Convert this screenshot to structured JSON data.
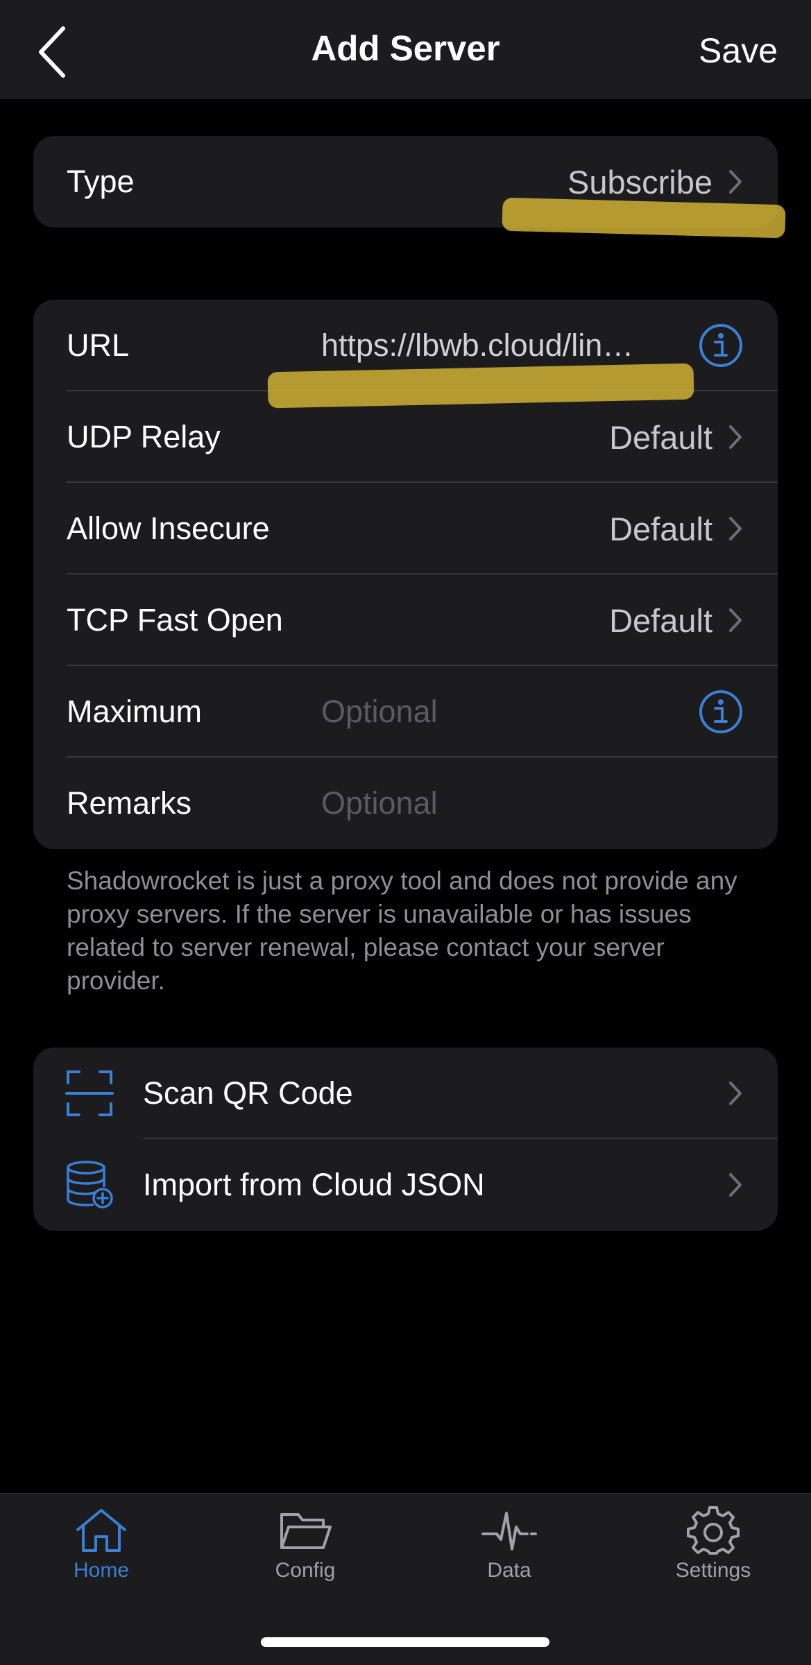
{
  "nav": {
    "title": "Add Server",
    "save_label": "Save",
    "back_icon": "chevron-left-icon"
  },
  "type_card": {
    "label": "Type",
    "value": "Subscribe"
  },
  "server_card": {
    "url": {
      "label": "URL",
      "value": "https://lbwb.cloud/lin…",
      "icon": "info-icon"
    },
    "udp_relay": {
      "label": "UDP Relay",
      "value": "Default"
    },
    "allow_insecure": {
      "label": "Allow Insecure",
      "value": "Default"
    },
    "tcp_fast_open": {
      "label": "TCP Fast Open",
      "value": "Default"
    },
    "maximum": {
      "label": "Maximum",
      "placeholder": "Optional",
      "icon": "info-icon"
    },
    "remarks": {
      "label": "Remarks",
      "placeholder": "Optional"
    }
  },
  "footer_note": "Shadowrocket is just a proxy tool and does not provide any proxy servers. If the server is unavailable or has issues related to server renewal, please contact your server provider.",
  "actions": {
    "scan_qr": {
      "label": "Scan QR Code",
      "icon": "qr-scan-icon"
    },
    "import_cloud": {
      "label": "Import from Cloud JSON",
      "icon": "database-add-icon"
    }
  },
  "tabbar": {
    "items": [
      {
        "label": "Home",
        "icon": "home-icon",
        "active": true
      },
      {
        "label": "Config",
        "icon": "folder-icon",
        "active": false
      },
      {
        "label": "Data",
        "icon": "pulse-icon",
        "active": false
      },
      {
        "label": "Settings",
        "icon": "gear-icon",
        "active": false
      }
    ]
  },
  "colors": {
    "accent": "#3b7fd6",
    "highlight": "#d6b634",
    "background": "#000000",
    "card": "#1c1c1e"
  }
}
